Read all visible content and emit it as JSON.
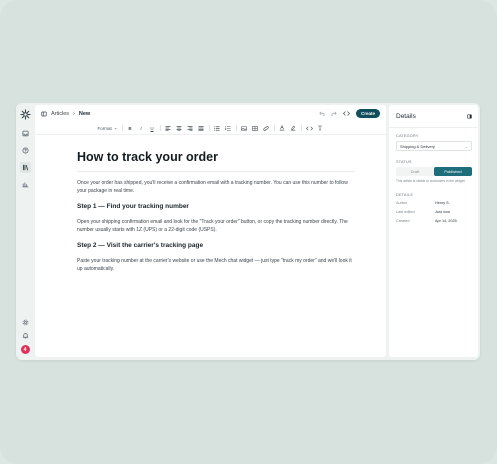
{
  "breadcrumb": {
    "parent": "Articles",
    "current": "New"
  },
  "actions": {
    "create_label": "Create"
  },
  "toolbar": {
    "format_label": "Format"
  },
  "article": {
    "title": "How to track your order",
    "intro": "Once your order has shipped, you'll receive a confirmation email with a tracking number. You can use this number to follow your package in real time.",
    "step1_heading": "Step 1 — Find your tracking number",
    "step1_body": "Open your shipping confirmation email and look for the \"Track your order\" button, or copy the tracking number directly. The number usually starts with 1Z (UPS) or a 22-digit code (USPS).",
    "step2_heading": "Step 2 — Visit the carrier's tracking page",
    "step2_body": "Paste your tracking number at the carrier's website or use the Mech chat widget — just type \"track my order\" and we'll look it up automatically."
  },
  "details": {
    "title": "Details",
    "category_label": "CATEGORY",
    "category_value": "Shipping & Delivery",
    "status_label": "STATUS",
    "status_options": [
      "Draft",
      "Published"
    ],
    "status_selected": "Published",
    "status_note": "This article is visible to customers in the widget.",
    "details_label": "DETAILS",
    "rows": [
      {
        "key": "Author",
        "value": "Henry S."
      },
      {
        "key": "Last edited",
        "value": "Just now"
      },
      {
        "key": "Created",
        "value": "Apr 14, 2025"
      }
    ]
  },
  "notification": {
    "badge": "4"
  },
  "colors": {
    "accent": "#0f4e5c",
    "published": "#1d6d7a",
    "badge": "#e0315a"
  }
}
